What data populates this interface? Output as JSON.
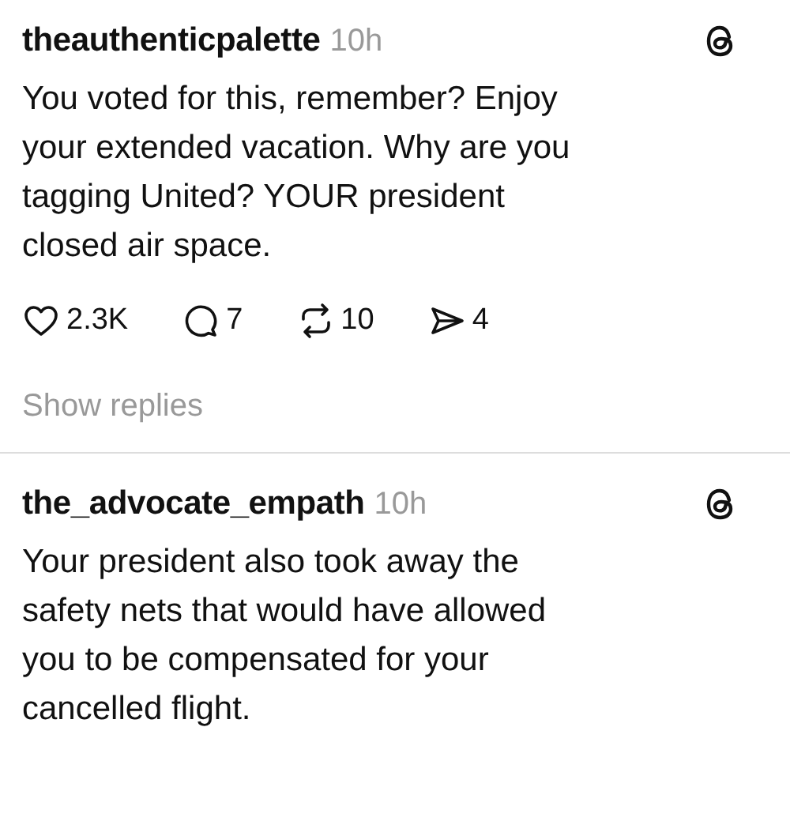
{
  "posts": [
    {
      "username": "theauthenticpalette",
      "time": "10h",
      "text": "You voted for this, remember? Enjoy\nyour extended vacation. Why are you\ntagging United? YOUR president\nclosed air space.",
      "actions": [
        {
          "kind": "like",
          "count": "2.3K"
        },
        {
          "kind": "reply",
          "count": "7"
        },
        {
          "kind": "repost",
          "count": "10"
        },
        {
          "kind": "share",
          "count": "4"
        }
      ],
      "show_replies": "Show replies"
    },
    {
      "username": "the_advocate_empath",
      "time": "10h",
      "text": "Your president also took away the\nsafety nets that would have allowed\nyou to be compensated for your\ncancelled flight."
    }
  ]
}
